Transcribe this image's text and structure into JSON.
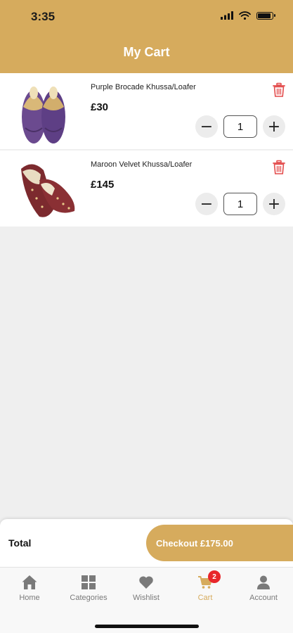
{
  "status_bar": {
    "time": "3:35",
    "battery_level": 0.9
  },
  "header": {
    "title": "My Cart"
  },
  "cart": {
    "items": [
      {
        "name": "Purple Brocade Khussa/Loafer",
        "price": "£30",
        "quantity": "1",
        "minus": "−",
        "plus": "+",
        "image": "purple-khussa-shoes"
      },
      {
        "name": "Maroon Velvet Khussa/Loafer",
        "price": "£145",
        "quantity": "1",
        "minus": "−",
        "plus": "+",
        "image": "maroon-velvet-khussa-shoes"
      }
    ]
  },
  "footer": {
    "total_label": "Total",
    "checkout_label": "Checkout £175.00"
  },
  "tabs": [
    {
      "label": "Home",
      "icon": "home-icon"
    },
    {
      "label": "Categories",
      "icon": "grid-icon"
    },
    {
      "label": "Wishlist",
      "icon": "heart-icon"
    },
    {
      "label": "Cart",
      "icon": "cart-icon",
      "badge": "2",
      "active": true
    },
    {
      "label": "Account",
      "icon": "user-icon"
    }
  ],
  "colors": {
    "brand": "#d6ab5d",
    "delete": "#e34c4c",
    "badge": "#e8262a",
    "tab_inactive": "#7a7a7a"
  }
}
